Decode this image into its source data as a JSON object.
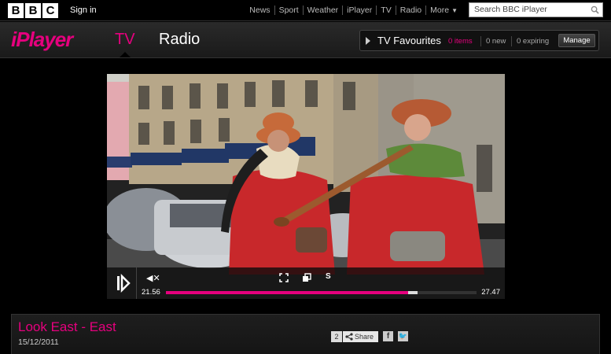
{
  "topbar": {
    "logo": [
      "B",
      "B",
      "C"
    ],
    "signin": "Sign in",
    "nav": [
      "News",
      "Sport",
      "Weather",
      "iPlayer",
      "TV",
      "Radio",
      "More"
    ],
    "search_placeholder": "Search BBC iPlayer"
  },
  "header": {
    "logo": "iPlayer",
    "tabs": {
      "tv": "TV",
      "radio": "Radio"
    },
    "favourites": {
      "title": "TV Favourites",
      "items": "0 items",
      "new": "0 new",
      "expiring": "0 expiring",
      "manage": "Manage"
    }
  },
  "player": {
    "current_time": "21.56",
    "total_time": "27.47",
    "progress": 0.78,
    "buffered": 0.81,
    "subtitle_label": "S"
  },
  "programme": {
    "title": "Look East - East",
    "date": "15/12/2011",
    "share_count": "2",
    "share_label": "Share"
  },
  "colors": {
    "accent": "#e6007e",
    "background": "#000000"
  }
}
